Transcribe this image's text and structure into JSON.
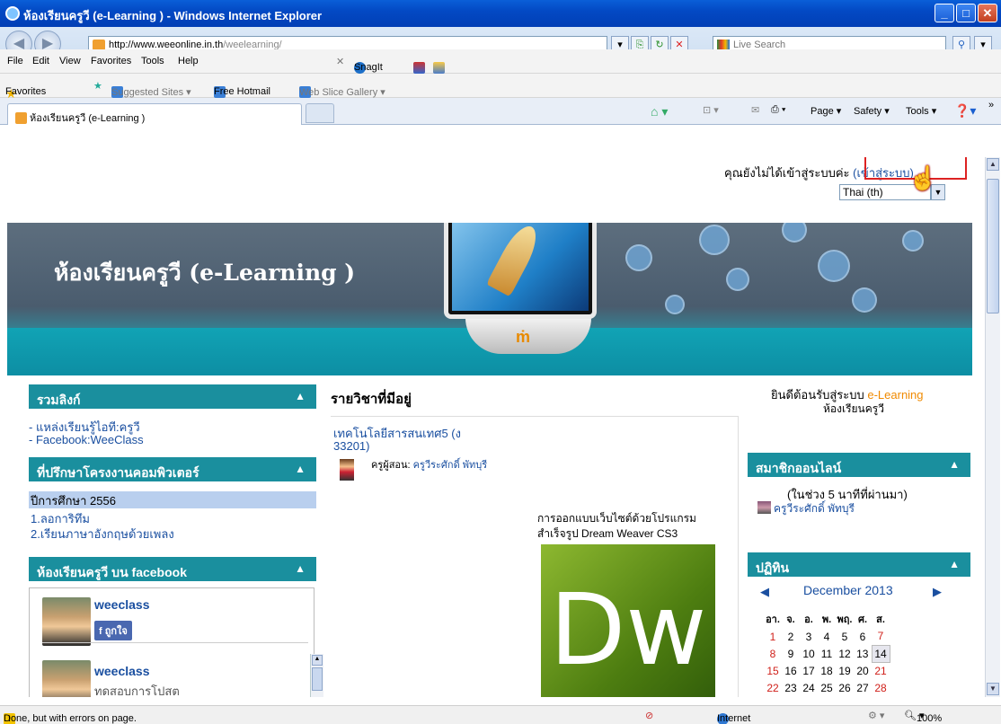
{
  "window": {
    "title": "ห้องเรียนครูวี (e-Learning ) - Windows Internet Explorer",
    "minimize": "_",
    "maximize": "□",
    "close": "✕"
  },
  "address": {
    "url_host": "http://www.weeonline.in.th",
    "url_path": "/weelearning/",
    "search_placeholder": "Live Search"
  },
  "menu": [
    "File",
    "Edit",
    "View",
    "Favorites",
    "Tools",
    "Help"
  ],
  "toolbar": {
    "snagit": "SnagIt"
  },
  "favorites": {
    "label": "Favorites",
    "items": [
      "Suggested Sites ▾",
      "Free Hotmail",
      "Web Slice Gallery ▾"
    ]
  },
  "tab": {
    "label": "ห้องเรียนครูวี (e-Learning )"
  },
  "commands": {
    "page": "Page ▾",
    "safety": "Safety ▾",
    "tools": "Tools ▾"
  },
  "page": {
    "login_text": "คุณยังไม่ได้เข้าสู่ระบบค่ะ",
    "login_link": "(เข้าสู่ระบบ)",
    "language": "Thai (th)",
    "site_title": "ห้องเรียนครูวี (e-Learning )",
    "left": {
      "links_head": "รวมลิงก์",
      "links": [
        "- แหล่งเรียนรู้ไอที:ครูวี",
        "- Facebook:WeeClass"
      ],
      "advisor_head": "ที่ปรึกษาโครงงานคอมพิวเตอร์",
      "year": "ปีการศึกษา 2556",
      "projects": [
        "1.ลอการิทึม",
        "2.เรียนภาษาอังกฤษด้วยเพลง"
      ],
      "fb_head": "ห้องเรียนครูวี บน facebook",
      "fb_name1": "weeclass",
      "fb_like": "ถูกใจ",
      "fb_name2": "weeclass",
      "fb_sub": "ทดสอบการโปสต"
    },
    "center": {
      "head": "รายวิชาที่มีอยู่",
      "course1_line1": "เทคโนโลยีสารสนเทศ5 (ง",
      "course1_line2": "33201)",
      "teacher_label": "ครูผู้สอน:",
      "teacher_name": "ครูวีระศักดิ์ พัทบุรี",
      "course2_line1": "การออกแบบเว็บไซต์ด้วยโปรแกรม",
      "course2_line2": "สำเร็จรูป Dream Weaver CS3",
      "dw": "Dw"
    },
    "right": {
      "welcome1": "ยินดีต้อนรับสู่ระบบ",
      "welcome_brand": "e-Learning",
      "welcome2": "ห้องเรียนครูวี",
      "online_head": "สมาชิกออนไลน์",
      "online_period": "(ในช่วง 5 นาทีที่ผ่านมา)",
      "online_user": "ครูวีระศักดิ์ พัทบุรี",
      "cal_head": "ปฏิทิน",
      "cal_month": "December 2013",
      "cal_days": [
        "อา.",
        "จ.",
        "อ.",
        "พ.",
        "พฤ.",
        "ศ.",
        "ส."
      ],
      "cal_weeks": [
        [
          "1",
          "2",
          "3",
          "4",
          "5",
          "6",
          "7"
        ],
        [
          "8",
          "9",
          "10",
          "11",
          "12",
          "13",
          "14"
        ],
        [
          "15",
          "16",
          "17",
          "18",
          "19",
          "20",
          "21"
        ],
        [
          "22",
          "23",
          "24",
          "25",
          "26",
          "27",
          "28"
        ]
      ]
    }
  },
  "status": {
    "text": "Done, but with errors on page.",
    "zone": "Internet",
    "zoom": "100%"
  }
}
